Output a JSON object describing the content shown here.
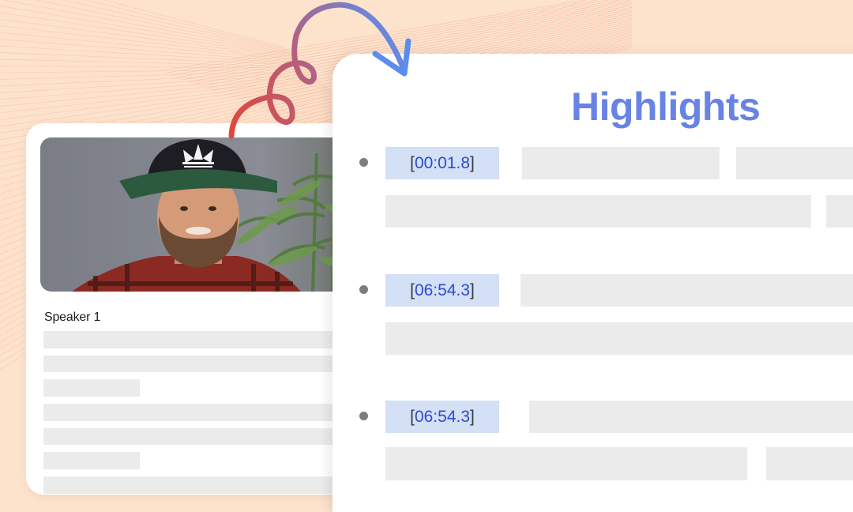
{
  "colors": {
    "background": "#fde2cc",
    "title_accent": "#6883e4",
    "timestamp_chip": "#d3e0f6",
    "timestamp_text": "#2b4bd2",
    "skeleton": "#ebebeb",
    "bullet": "#7d7d7d",
    "arrow_gradient_start": "#e2473a",
    "arrow_gradient_end": "#5b8def"
  },
  "transcript": {
    "video": {
      "alt": "Speaker video thumbnail: man in black cap with green brim and red plaid shirt in front of a bamboo plant"
    },
    "speaker_label": "Speaker 1",
    "placeholder_lines": 7
  },
  "highlights": {
    "title": "Highlights",
    "items": [
      {
        "open_bracket": "[ ",
        "timestamp": "00:01.8",
        "close_bracket": "]"
      },
      {
        "open_bracket": "[ ",
        "timestamp": "06:54.3",
        "close_bracket": "]"
      },
      {
        "open_bracket": "[ ",
        "timestamp": "06:54.3",
        "close_bracket": "]"
      }
    ]
  },
  "icons": {
    "arrow": "curly-arrow-icon",
    "bullet": "bullet-dot-icon"
  }
}
